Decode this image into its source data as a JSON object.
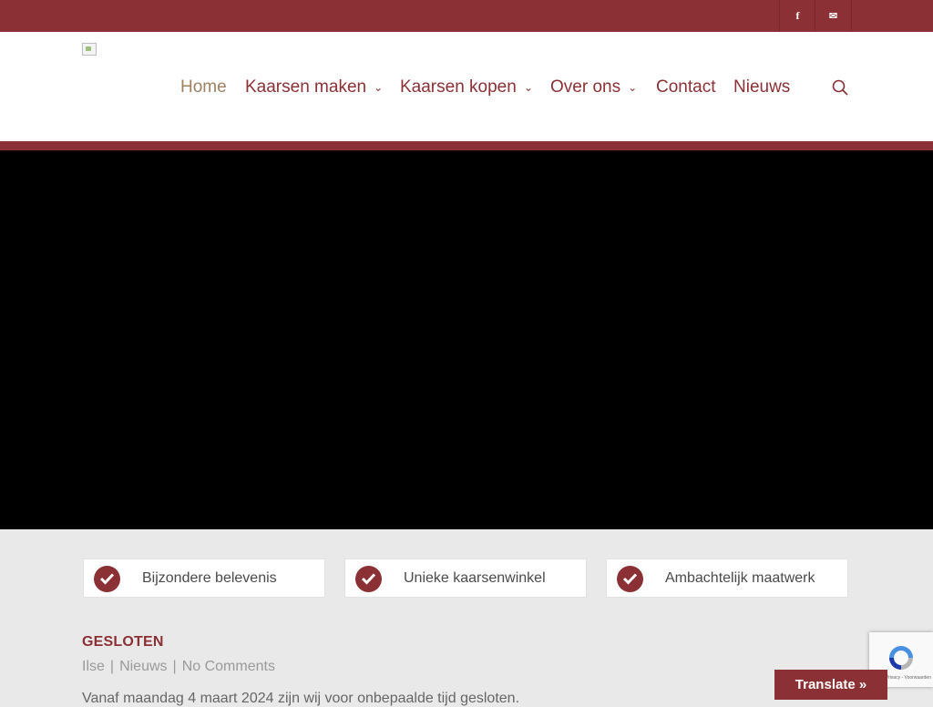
{
  "topbar": {
    "social": [
      {
        "name": "facebook",
        "glyph": "f"
      },
      {
        "name": "email",
        "glyph": "✉"
      }
    ]
  },
  "nav": {
    "items": [
      {
        "label": "Home",
        "active": true,
        "has_dropdown": false
      },
      {
        "label": "Kaarsen maken",
        "has_dropdown": true
      },
      {
        "label": "Kaarsen kopen",
        "has_dropdown": true
      },
      {
        "label": "Over ons",
        "has_dropdown": true
      },
      {
        "label": "Contact",
        "has_dropdown": false
      },
      {
        "label": "Nieuws",
        "has_dropdown": false
      }
    ],
    "chevron": "⌄"
  },
  "features": [
    {
      "label": "Bijzondere belevenis"
    },
    {
      "label": "Unieke kaarsenwinkel"
    },
    {
      "label": "Ambachtelijk maatwerk"
    }
  ],
  "post": {
    "title": "GESLOTEN",
    "meta": {
      "author": "Ilse",
      "category": "Nieuws",
      "comments": "No Comments",
      "separator": "|"
    },
    "excerpt": "Vanaf maandag 4 maart 2024 zijn wij voor onbepaalde tijd gesloten."
  },
  "recaptcha": {
    "text": "Privacy - Voorwaarden"
  },
  "translate": {
    "label": "Translate »"
  },
  "colors": {
    "brand": "#8b3034",
    "active_nav": "#a08062",
    "background": "#e9e9e9"
  }
}
